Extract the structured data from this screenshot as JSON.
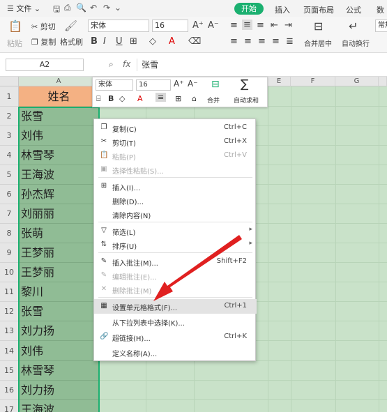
{
  "menubar": {
    "file": "文件",
    "tabs": [
      "开始",
      "插入",
      "页面布局",
      "公式",
      "数据"
    ]
  },
  "ribbon": {
    "paste": "粘贴",
    "cut": "剪切",
    "copy": "复制",
    "format_painter": "格式刷",
    "font": "宋体",
    "size": "16",
    "merge": "合并居中",
    "wrap": "自动换行",
    "normal": "常规"
  },
  "formula": {
    "cell_ref": "A2",
    "fx": "fx",
    "value": "张雪"
  },
  "columns": [
    "A",
    "E",
    "F",
    "G"
  ],
  "rows": [
    "1",
    "2",
    "3",
    "4",
    "5",
    "6",
    "7",
    "8",
    "9",
    "10",
    "11",
    "12",
    "13",
    "14",
    "15",
    "16",
    "17"
  ],
  "cells": [
    "姓名",
    "张雪",
    "刘伟",
    "林雪琴",
    "王海波",
    "孙杰辉",
    "刘丽丽",
    "张萌",
    "王梦丽",
    "王梦丽",
    "黎川",
    "张雪",
    "刘力扬",
    "刘伟",
    "林雪琴",
    "刘力扬",
    "王海波"
  ],
  "minitoolbar": {
    "font": "宋体",
    "size": "16",
    "merge": "合并",
    "autosum": "自动求和"
  },
  "context_menu": [
    {
      "label": "复制(C)",
      "shortcut": "Ctrl+C",
      "icon": "copy-icon",
      "disabled": false
    },
    {
      "label": "剪切(T)",
      "shortcut": "Ctrl+X",
      "icon": "scissors-icon",
      "disabled": false
    },
    {
      "label": "粘贴(P)",
      "shortcut": "Ctrl+V",
      "icon": "paste-icon",
      "disabled": true
    },
    {
      "label": "选择性粘贴(S)...",
      "shortcut": "",
      "icon": "paste-special-icon",
      "disabled": true
    },
    {
      "label": "插入(I)...",
      "shortcut": "",
      "icon": "insert-icon",
      "disabled": false
    },
    {
      "label": "删除(D)...",
      "shortcut": "",
      "icon": "",
      "disabled": false
    },
    {
      "label": "清除内容(N)",
      "shortcut": "",
      "icon": "",
      "disabled": false
    },
    {
      "label": "筛选(L)",
      "shortcut": "",
      "icon": "filter-icon",
      "disabled": false
    },
    {
      "label": "排序(U)",
      "shortcut": "",
      "icon": "sort-icon",
      "disabled": false
    },
    {
      "label": "插入批注(M)...",
      "shortcut": "Shift+F2",
      "icon": "comment-icon",
      "disabled": false
    },
    {
      "label": "编辑批注(E)...",
      "shortcut": "",
      "icon": "edit-comment-icon",
      "disabled": true
    },
    {
      "label": "删除批注(M)",
      "shortcut": "",
      "icon": "delete-comment-icon",
      "disabled": true
    },
    {
      "label": "设置单元格格式(F)...",
      "shortcut": "Ctrl+1",
      "icon": "format-cells-icon",
      "disabled": false
    },
    {
      "label": "从下拉列表中选择(K)...",
      "shortcut": "",
      "icon": "",
      "disabled": false
    },
    {
      "label": "超链接(H)...",
      "shortcut": "Ctrl+K",
      "icon": "link-icon",
      "disabled": false
    },
    {
      "label": "定义名称(A)...",
      "shortcut": "",
      "icon": "",
      "disabled": false
    }
  ],
  "colors": {
    "accent": "#1bb070",
    "selection": "#90bc95",
    "header_cell": "#f4b183",
    "arrow": "#e02020"
  }
}
